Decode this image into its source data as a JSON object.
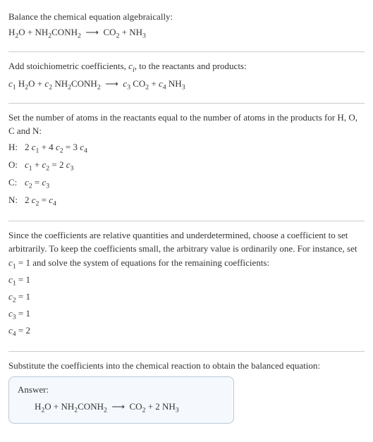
{
  "title_line1": "Balance the chemical equation algebraically:",
  "title_eqn_html": "H<sub>2</sub>O + NH<sub>2</sub>CONH<sub>2</sub>&nbsp;&nbsp;⟶&nbsp;&nbsp;CO<sub>2</sub> + NH<sub>3</sub>",
  "stoich_intro_html": "Add stoichiometric coefficients, <span class=\"var\">c</span><span class=\"sub-italic\">i</span>, to the reactants and products:",
  "stoich_eqn_html": "<span class=\"var\">c</span><sub>1</sub> H<sub>2</sub>O + <span class=\"var\">c</span><sub>2</sub> NH<sub>2</sub>CONH<sub>2</sub>&nbsp;&nbsp;⟶&nbsp;&nbsp;<span class=\"var\">c</span><sub>3</sub> CO<sub>2</sub> + <span class=\"var\">c</span><sub>4</sub> NH<sub>3</sub>",
  "atoms_intro": "Set the number of atoms in the reactants equal to the number of atoms in the products for H, O, C and N:",
  "atom_rows": [
    {
      "label": "H:",
      "eq_html": "2 <span class=\"var\">c</span><sub>1</sub> + 4 <span class=\"var\">c</span><sub>2</sub> = 3 <span class=\"var\">c</span><sub>4</sub>"
    },
    {
      "label": "O:",
      "eq_html": "<span class=\"var\">c</span><sub>1</sub> + <span class=\"var\">c</span><sub>2</sub> = 2 <span class=\"var\">c</span><sub>3</sub>"
    },
    {
      "label": "C:",
      "eq_html": "<span class=\"var\">c</span><sub>2</sub> = <span class=\"var\">c</span><sub>3</sub>"
    },
    {
      "label": "N:",
      "eq_html": "2 <span class=\"var\">c</span><sub>2</sub> = <span class=\"var\">c</span><sub>4</sub>"
    }
  ],
  "choose_intro_html": "Since the coefficients are relative quantities and underdetermined, choose a coefficient to set arbitrarily. To keep the coefficients small, the arbitrary value is ordinarily one. For instance, set <span class=\"var\">c</span><sub>1</sub> = 1 and solve the system of equations for the remaining coefficients:",
  "coef_lines": [
    "<span class=\"var\">c</span><sub>1</sub> = 1",
    "<span class=\"var\">c</span><sub>2</sub> = 1",
    "<span class=\"var\">c</span><sub>3</sub> = 1",
    "<span class=\"var\">c</span><sub>4</sub> = 2"
  ],
  "subst_intro": "Substitute the coefficients into the chemical reaction to obtain the balanced equation:",
  "answer_label": "Answer:",
  "answer_eqn_html": "H<sub>2</sub>O + NH<sub>2</sub>CONH<sub>2</sub>&nbsp;&nbsp;⟶&nbsp;&nbsp;CO<sub>2</sub> + 2 NH<sub>3</sub>"
}
